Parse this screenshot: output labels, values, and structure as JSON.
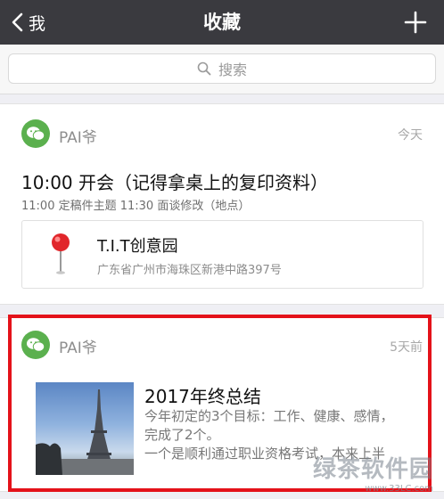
{
  "nav": {
    "back_label": "我",
    "title": "收藏"
  },
  "search": {
    "placeholder": "搜索"
  },
  "items": [
    {
      "source": "PAI爷",
      "time": "今天",
      "title": "10:00 开会（记得拿桌上的复印资料）",
      "subtitle": "11:00 定稿件主题 11:30 面谈修改（地点）",
      "location": {
        "name": "T.I.T创意园",
        "address": "广东省广州市海珠区新港中路397号"
      }
    },
    {
      "source": "PAI爷",
      "time": "5天前",
      "title": "2017年终总结",
      "body_lines": [
        "今年初定的3个目标：工作、健康、感情，",
        "完成了2个。",
        "一个是顺利通过职业资格考试，本来上半"
      ]
    }
  ],
  "watermark": {
    "main": "绿茶软件园",
    "url": "www.33LC.com"
  },
  "colors": {
    "navbar": "#3a3a3f",
    "wechat_green": "#5bb04e",
    "highlight_red": "#e4121a"
  },
  "icons": [
    "back-chevron-icon",
    "plus-icon",
    "search-icon",
    "wechat-icon",
    "map-pin-icon"
  ]
}
